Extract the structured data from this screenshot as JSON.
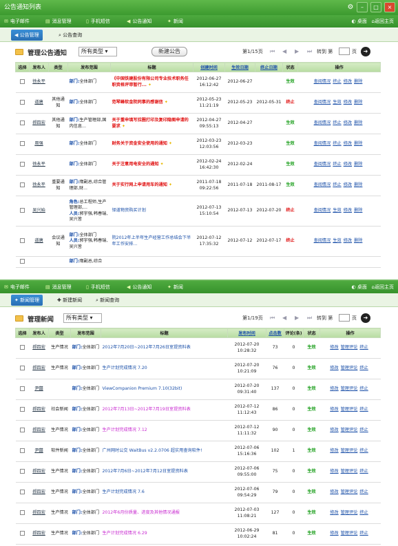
{
  "window": {
    "title": "公告通知列表"
  },
  "nav": {
    "items": [
      "电子邮件",
      "消息管理",
      "手机短信",
      "公告通知",
      "新闻"
    ],
    "desktop": "桌面",
    "home": "返回主页"
  },
  "ann": {
    "tabs": [
      "公告管理",
      "公告查询"
    ],
    "title": "管理公告通知",
    "type_select": "所有类型",
    "new_button": "新建公告",
    "pager": {
      "page": "第1/15页",
      "goto": "转到 第",
      "page_unit": "页"
    },
    "headers": [
      "选择",
      "发布人",
      "类型",
      "发布范围",
      "标题",
      "创建时间",
      "生效日期",
      "终止日期",
      "状态",
      "操作"
    ],
    "rows": [
      {
        "publisher": "徐永平",
        "type": "",
        "scope_label": "部门:",
        "scope": "全体部门",
        "title": "《中国铁建股份有限公司专业技术职务任职资格评审暂行...",
        "title_color": "red",
        "star": true,
        "created": "2012-06-27 16:12:42",
        "start": "2012-06-27",
        "end": "",
        "status": "生效",
        "actions": [
          "查阅情况",
          "终止",
          "修改",
          "删除"
        ]
      },
      {
        "publisher": "道唐",
        "type": "其他通知",
        "scope_label": "部门:",
        "scope": "全体部门",
        "title": "范琴峰软金院同事的感谢信",
        "title_color": "red",
        "star": true,
        "created": "2012-05-23 11:21:19",
        "start": "2012-05-23",
        "end": "2012-05-31",
        "status": "终止",
        "actions": [
          "查阅情况",
          "生效",
          "修改",
          "删除"
        ]
      },
      {
        "publisher": "郝四宏",
        "type": "其他通知",
        "scope_label": "部门:",
        "scope": "生产管理部,国内信息...",
        "title": "关于重申填写拉圈打印及复印隐图申请的要求",
        "title_color": "red",
        "star": true,
        "created": "2012-04-27 09:55:13",
        "start": "2012-04-27",
        "end": "",
        "status": "生效",
        "actions": [
          "查阅情况",
          "终止",
          "修改",
          "删除"
        ]
      },
      {
        "publisher": "周强",
        "type": "",
        "scope_label": "部门:",
        "scope": "全体部门",
        "title": "财务关于资金安全使用的通知",
        "title_color": "red",
        "star": true,
        "created": "2012-03-23 12:03:56",
        "start": "2012-03-23",
        "end": "",
        "status": "生效",
        "actions": [
          "查阅情况",
          "终止",
          "修改",
          "删除"
        ]
      },
      {
        "publisher": "徐永平",
        "type": "",
        "scope_label": "部门:",
        "scope": "全体部门",
        "title": "关于注意用电安全的通知",
        "title_color": "red",
        "star": true,
        "created": "2012-02-24 16:42:30",
        "start": "2012-02-24",
        "end": "",
        "status": "生效",
        "actions": [
          "查阅情况",
          "终止",
          "修改",
          "删除"
        ]
      },
      {
        "publisher": "徐永平",
        "type": "重要通知",
        "scope_label": "部门:",
        "scope": "隋副总,综合管理部,财...",
        "title": "关于实行网上申请用车的通知",
        "title_color": "red",
        "star": true,
        "created": "2011-07-18 09:22:56",
        "start": "2011-07-18",
        "end": "2011-08-17",
        "status": "生效",
        "actions": [
          "查阅情况",
          "终止",
          "修改",
          "删除"
        ]
      },
      {
        "publisher": "吴兴始",
        "type": "",
        "scope_label": "角色:",
        "scope": "总工程师,生产管理部,...",
        "scope2_label": "人员:",
        "scope2": "郭宇强,韩春瑞,吴兴皆",
        "title": "铎道物资购买计划",
        "title_color": "blue",
        "star": false,
        "created": "2012-07-13 15:10:54",
        "start": "2012-07-13",
        "end": "2012-07-20",
        "status": "终止",
        "actions": [
          "查阅情况",
          "生效",
          "修改",
          "删除"
        ]
      },
      {
        "publisher": "道唐",
        "type": "会议通知",
        "scope_label": "部门:",
        "scope": "全体部门",
        "scope2_label": "人员:",
        "scope2": "郭宇强,韩春瑞,吴兴皆",
        "title": "院2012年上半年生产经营工作总结会下半年工作安排...",
        "title_color": "blue",
        "star": false,
        "created": "2012-07-12 17:35:32",
        "start": "2012-07-12",
        "end": "2012-07-17",
        "status": "终止",
        "actions": [
          "查阅情况",
          "生效",
          "修改",
          "删除"
        ]
      },
      {
        "publisher": "",
        "type": "",
        "scope_label": "部门:",
        "scope": "隋副总,综合",
        "title": "",
        "title_color": "blue",
        "star": false,
        "created": "",
        "start": "",
        "end": "",
        "status": "",
        "actions": []
      }
    ]
  },
  "news": {
    "tabs": [
      "新闻管理",
      "新建新闻",
      "新闻查询"
    ],
    "title": "管理新闻",
    "type_select": "所有类型",
    "pager": {
      "page": "第1/19页",
      "goto": "转到 第",
      "page_unit": "页"
    },
    "headers": [
      "选择",
      "发布人",
      "类型",
      "发布范围",
      "标题",
      "发布时间",
      "点击数",
      "评论(条)",
      "状态",
      "操作"
    ],
    "rows": [
      {
        "publisher": "郝四宏",
        "type": "生产情况",
        "scope_label": "部门:",
        "scope": "全体部门",
        "title": "2012年7月20日~2012年7月26日室提资料表",
        "title_color": "blue",
        "time": "2012-07-20 10:28:32",
        "clicks": "73",
        "comments": "0",
        "status": "生效",
        "actions": [
          "修改",
          "管理评论",
          "终止"
        ]
      },
      {
        "publisher": "郝四宏",
        "type": "生产情况",
        "scope_label": "部门:",
        "scope": "全体部门",
        "title": "生产计划完成情况 7.20",
        "title_color": "blue",
        "time": "2012-07-20 10:21:09",
        "clicks": "76",
        "comments": "0",
        "status": "生效",
        "actions": [
          "修改",
          "管理评论",
          "终止"
        ]
      },
      {
        "publisher": "尹囍",
        "type": "",
        "scope_label": "部门:",
        "scope": "全体部门",
        "title": "ViewCompanion Premium 7.10(32bit)",
        "title_color": "blue",
        "time": "2012-07-20 09:31:40",
        "clicks": "137",
        "comments": "0",
        "status": "生效",
        "actions": [
          "修改",
          "管理评论",
          "终止"
        ]
      },
      {
        "publisher": "郝四宏",
        "type": "社会新闻",
        "scope_label": "部门:",
        "scope": "全体部门",
        "title": "2012年7月13日~2012年7月19日室提资料表",
        "title_color": "mag",
        "time": "2012-07-12 11:12:43",
        "clicks": "86",
        "comments": "0",
        "status": "生效",
        "actions": [
          "修改",
          "管理评论",
          "终止"
        ]
      },
      {
        "publisher": "郝四宏",
        "type": "生产情况",
        "scope_label": "部门:",
        "scope": "全体部门",
        "title": "生产计划完成情况 7.12",
        "title_color": "mag",
        "time": "2012-07-12 11:11:32",
        "clicks": "90",
        "comments": "0",
        "status": "生效",
        "actions": [
          "修改",
          "管理评论",
          "终止"
        ]
      },
      {
        "publisher": "尹囍",
        "type": "软件新闻",
        "scope_label": "部门:",
        "scope": "全体部门",
        "title": "广州网时公交 WaitBus v2.2.0706 超实用查询软件!",
        "title_color": "blue",
        "time": "2012-07-06 15:16:36",
        "clicks": "102",
        "comments": "1",
        "status": "生效",
        "actions": [
          "修改",
          "管理评论",
          "终止"
        ]
      },
      {
        "publisher": "郝四宏",
        "type": "生产情况",
        "scope_label": "部门:",
        "scope": "全体部门",
        "title": "2012年7月6日~2012年7月12日室提资料表",
        "title_color": "blue",
        "time": "2012-07-06 09:55:00",
        "clicks": "75",
        "comments": "0",
        "status": "生效",
        "actions": [
          "修改",
          "管理评论",
          "终止"
        ]
      },
      {
        "publisher": "郝四宏",
        "type": "生产情况",
        "scope_label": "部门:",
        "scope": "全体部门",
        "title": "生产计划完成情况 7.6",
        "title_color": "blue",
        "time": "2012-07-06 09:54:29",
        "clicks": "79",
        "comments": "0",
        "status": "生效",
        "actions": [
          "修改",
          "管理评论",
          "终止"
        ]
      },
      {
        "publisher": "郝四宏",
        "type": "生产情况",
        "scope_label": "部门:",
        "scope": "全体部门",
        "title": "2012年6月份质量、进度及其他情况通报",
        "title_color": "mag",
        "time": "2012-07-03 11:08:21",
        "clicks": "127",
        "comments": "0",
        "status": "生效",
        "actions": [
          "修改",
          "管理评论",
          "终止"
        ]
      },
      {
        "publisher": "郝四宏",
        "type": "生产情况",
        "scope_label": "部门:",
        "scope": "全体部门",
        "title": "生产计划完成情况 6.29",
        "title_color": "mag",
        "time": "2012-06-29 10:02:24",
        "clicks": "81",
        "comments": "0",
        "status": "生效",
        "actions": [
          "修改",
          "管理评论",
          "终止"
        ]
      }
    ]
  }
}
